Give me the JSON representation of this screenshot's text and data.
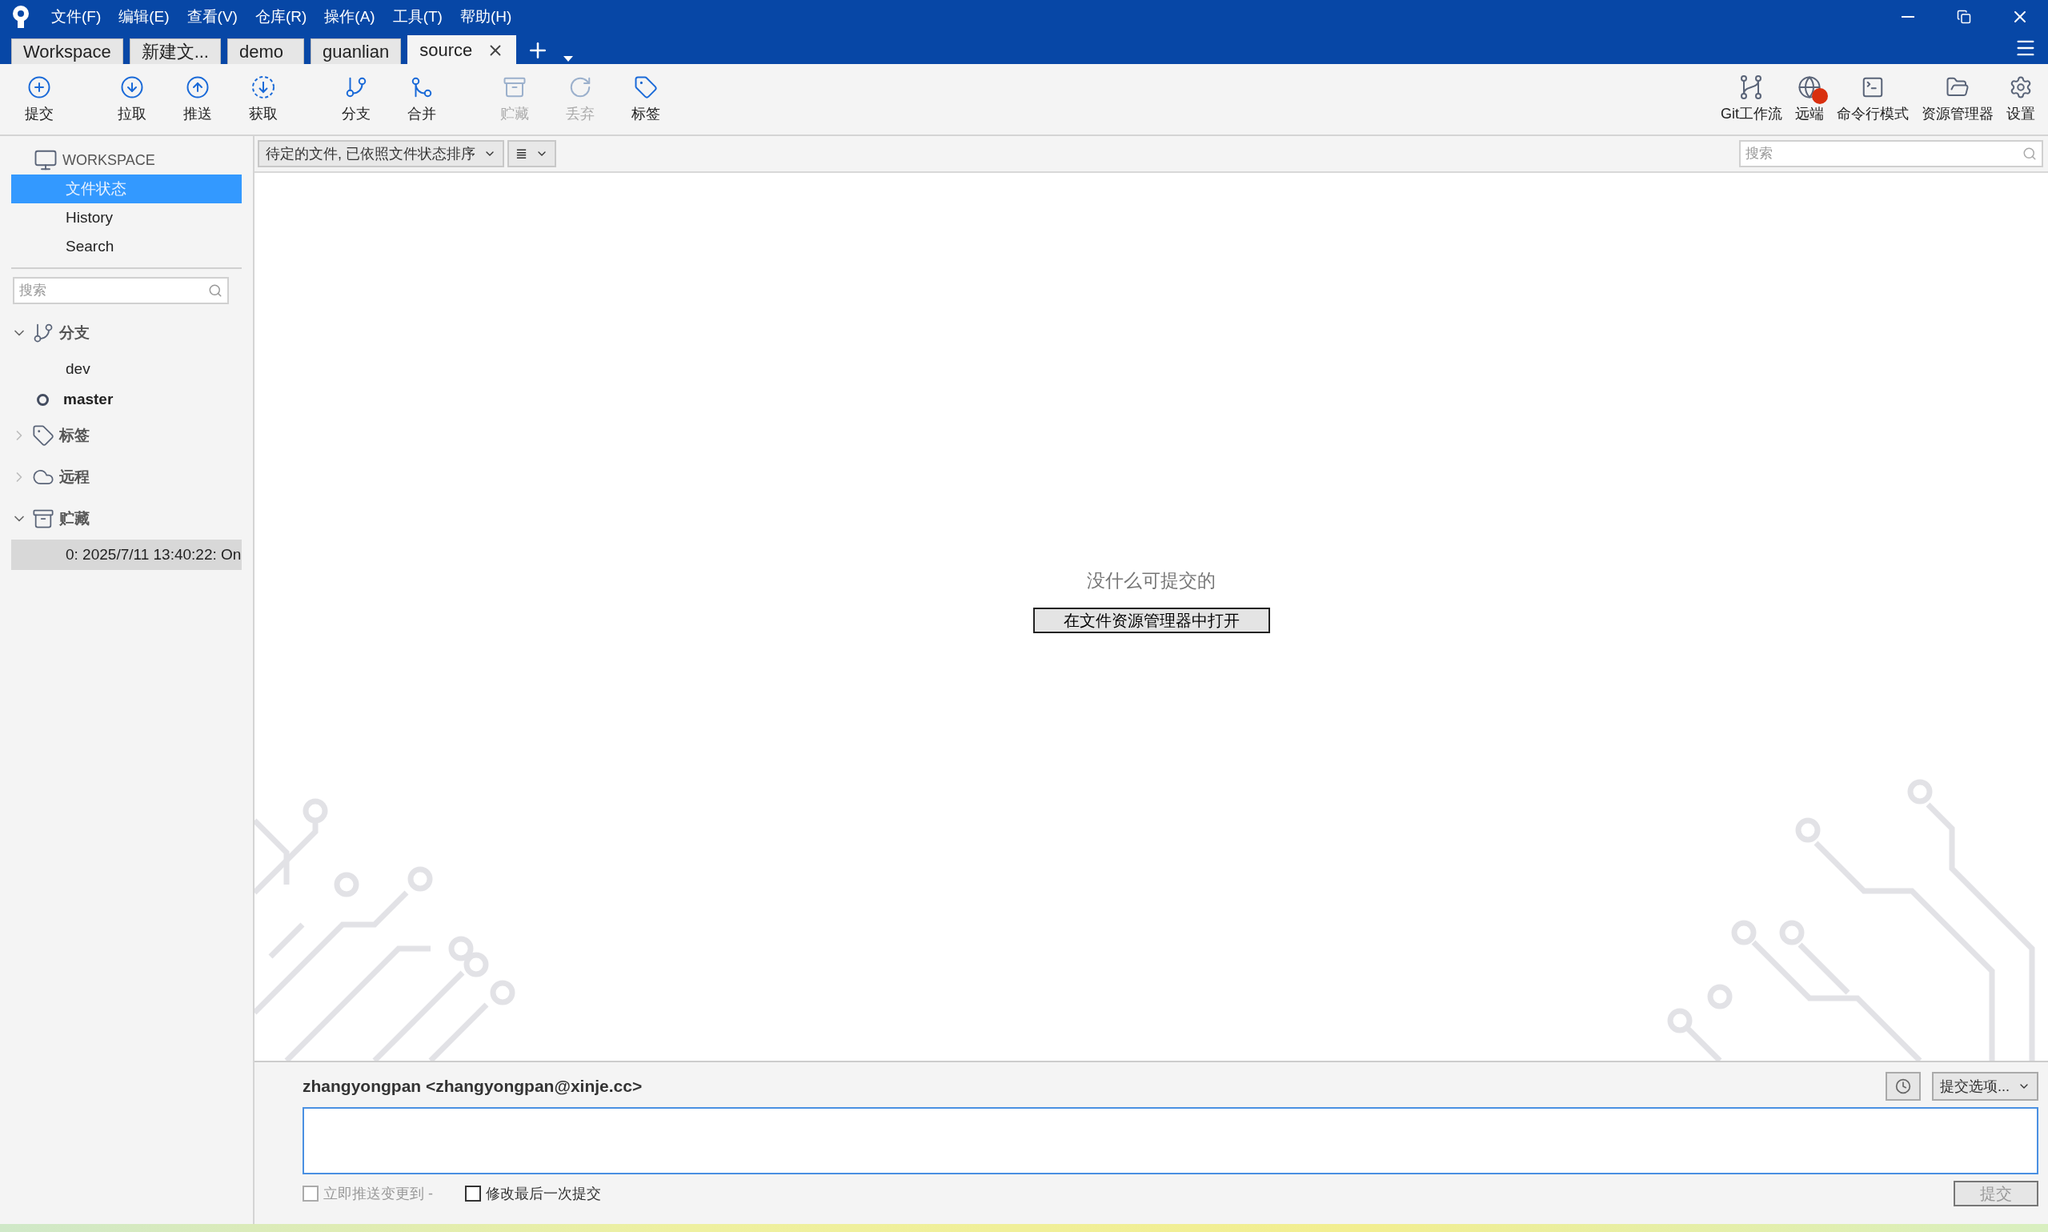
{
  "menu": [
    "文件(F)",
    "编辑(E)",
    "查看(V)",
    "仓库(R)",
    "操作(A)",
    "工具(T)",
    "帮助(H)"
  ],
  "tabs": [
    {
      "label": "Workspace",
      "selected": false
    },
    {
      "label": "新建文...",
      "selected": false
    },
    {
      "label": "demo",
      "selected": false
    },
    {
      "label": "guanlian",
      "selected": false
    },
    {
      "label": "source",
      "selected": true
    }
  ],
  "toolbar": {
    "groups": [
      {
        "items": [
          {
            "label": "提交",
            "disabled": false
          }
        ]
      },
      {
        "items": [
          {
            "label": "拉取",
            "disabled": false
          },
          {
            "label": "推送",
            "disabled": false
          },
          {
            "label": "获取",
            "disabled": false
          }
        ]
      },
      {
        "items": [
          {
            "label": "分支",
            "disabled": false
          },
          {
            "label": "合并",
            "disabled": false
          }
        ]
      },
      {
        "items": [
          {
            "label": "贮藏",
            "disabled": true
          },
          {
            "label": "丢弃",
            "disabled": true
          },
          {
            "label": "标签",
            "disabled": false
          }
        ]
      }
    ],
    "right_items": [
      {
        "label": "Git工作流",
        "disabled": false
      },
      {
        "label": "远端",
        "disabled": false
      },
      {
        "label": "命令行模式",
        "disabled": false
      },
      {
        "label": "资源管理器",
        "disabled": false
      },
      {
        "label": "设置",
        "disabled": false
      }
    ]
  },
  "sidebar": {
    "header": "WORKSPACE",
    "nav": [
      {
        "label": "文件状态",
        "selected": true
      },
      {
        "label": "History",
        "selected": false
      },
      {
        "label": "Search",
        "selected": false
      }
    ],
    "search": {
      "placeholder": "搜索"
    },
    "sections": [
      {
        "label": "分支",
        "expanded": true,
        "children": [
          {
            "label": "dev",
            "current": false,
            "selected": false
          },
          {
            "label": "master",
            "current": true,
            "selected": false
          }
        ]
      },
      {
        "label": "标签",
        "expanded": false
      },
      {
        "label": "远程",
        "expanded": false
      },
      {
        "label": "贮藏",
        "expanded": true,
        "children": [
          {
            "label": "0: 2025/7/11 13:40:22: On",
            "current": false,
            "selected": true
          }
        ]
      }
    ]
  },
  "file_list": {
    "filter": "待定的文件, 已依照文件状态排序",
    "view_menu": "≣",
    "search": {
      "placeholder": "搜索"
    },
    "empty_message": "没什么可提交的",
    "open_button": "在文件资源管理器中打开"
  },
  "commit": {
    "author": "zhangyongpan <zhangyongpan@xinje.cc>",
    "options": "提交选项...",
    "options_list": [
      {
        "label": "立即推送变更到 -",
        "checked": false,
        "disabled": true
      },
      {
        "label": "修改最后一次提交",
        "checked": false,
        "disabled": false
      }
    ],
    "submit": {
      "label": "提交",
      "disabled": true
    }
  }
}
